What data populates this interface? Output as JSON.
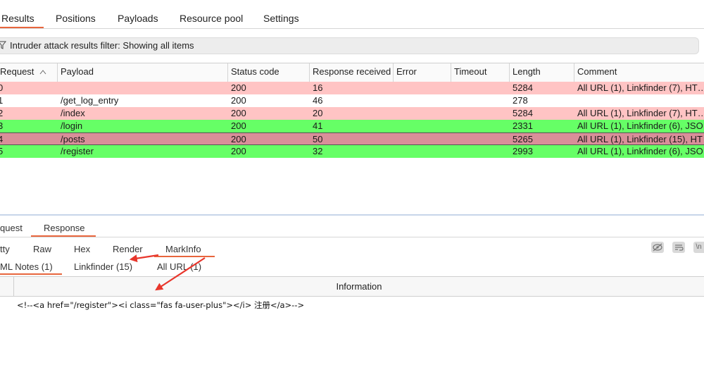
{
  "top_tabs": {
    "results": "Results",
    "positions": "Positions",
    "payloads": "Payloads",
    "resource_pool": "Resource pool",
    "settings": "Settings"
  },
  "filter": {
    "text": "Intruder attack results filter: Showing all items"
  },
  "table": {
    "headers": {
      "request": "Request",
      "payload": "Payload",
      "status": "Status code",
      "response_received": "Response received",
      "error": "Error",
      "timeout": "Timeout",
      "length": "Length",
      "comment": "Comment"
    },
    "rows": [
      {
        "request": "0",
        "payload": "",
        "status": "200",
        "received": "16",
        "error": "",
        "timeout": "",
        "length": "5284",
        "comment": "All URL (1), Linkfinder (7), HT…",
        "color": "#ffc4c4"
      },
      {
        "request": "1",
        "payload": "/get_log_entry",
        "status": "200",
        "received": "46",
        "error": "",
        "timeout": "",
        "length": "278",
        "comment": "",
        "color": "#ffffff"
      },
      {
        "request": "2",
        "payload": "/index",
        "status": "200",
        "received": "20",
        "error": "",
        "timeout": "",
        "length": "5284",
        "comment": "All URL (1), Linkfinder (7), HT…",
        "color": "#ffc4c4"
      },
      {
        "request": "3",
        "payload": "/login",
        "status": "200",
        "received": "41",
        "error": "",
        "timeout": "",
        "length": "2331",
        "comment": "All URL (1), Linkfinder (6), JSO…",
        "color": "#66ff66"
      },
      {
        "request": "4",
        "payload": "/posts",
        "status": "200",
        "received": "50",
        "error": "",
        "timeout": "",
        "length": "5265",
        "comment": "All URL (1), Linkfinder (15), HT…",
        "color": "#d98f99"
      },
      {
        "request": "5",
        "payload": "/register",
        "status": "200",
        "received": "32",
        "error": "",
        "timeout": "",
        "length": "2993",
        "comment": "All URL (1), Linkfinder (6), JSO…",
        "color": "#66ff66"
      }
    ]
  },
  "bottom_tabs": {
    "request": "quest",
    "response": "Response"
  },
  "view_tabs": {
    "pretty": "tty",
    "raw": "Raw",
    "hex": "Hex",
    "render": "Render",
    "markinfo": "MarkInfo"
  },
  "markinfo_tabs": {
    "html_notes": "ML Notes (1)",
    "linkfinder": "Linkfinder (15)",
    "all_url": "All URL (1)"
  },
  "info_table": {
    "header": "Information",
    "row": "<!--<a href=\"/register\"><i class=\"fas fa-user-plus\"></i> 注册</a>-->"
  },
  "toolbar": {
    "wrap_icon_text": "\\n"
  },
  "colors": {
    "accent": "#e8663d",
    "arrow": "#e8362c",
    "pink_row": "#ffc4c4",
    "green_row": "#66ff66",
    "mauve_row": "#d98f99"
  }
}
